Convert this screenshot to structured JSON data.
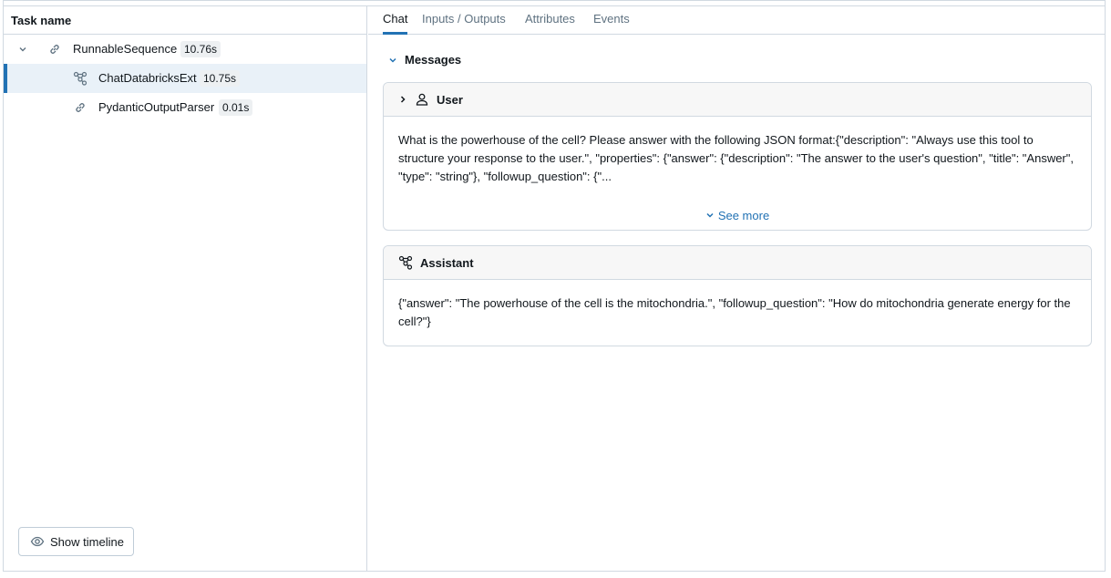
{
  "left_panel": {
    "header": "Task name",
    "tree": [
      {
        "label": "RunnableSequence",
        "duration": "10.76s",
        "icon": "link-icon",
        "expanded": true,
        "selected": false
      },
      {
        "label": "ChatDatabricksExt",
        "duration": "10.75s",
        "icon": "model-icon",
        "selected": true
      },
      {
        "label": "PydanticOutputParser",
        "duration": "0.01s",
        "icon": "link-icon",
        "selected": false
      }
    ],
    "timeline_button": "Show timeline"
  },
  "right_panel": {
    "tabs": [
      {
        "label": "Chat",
        "active": true
      },
      {
        "label": "Inputs / Outputs",
        "active": false
      },
      {
        "label": "Attributes",
        "active": false
      },
      {
        "label": "Events",
        "active": false
      }
    ],
    "messages_label": "Messages",
    "messages": [
      {
        "role": "User",
        "icon": "user-icon",
        "text": "What is the powerhouse of the cell? Please answer with the following JSON format:{\"description\": \"Always use this tool to structure your response to the user.\", \"properties\": {\"answer\": {\"description\": \"The answer to the user's question\", \"title\": \"Answer\", \"type\": \"string\"}, \"followup_question\": {\"...",
        "see_more": "See more"
      },
      {
        "role": "Assistant",
        "icon": "model-icon",
        "text": "{\"answer\": \"The powerhouse of the cell is the mitochondria.\", \"followup_question\": \"How do mitochondria generate energy for the cell?\"}"
      }
    ]
  },
  "colors": {
    "accent": "#2272b4",
    "selected_row": "#e9f1f8",
    "border": "#d1d9e1"
  }
}
